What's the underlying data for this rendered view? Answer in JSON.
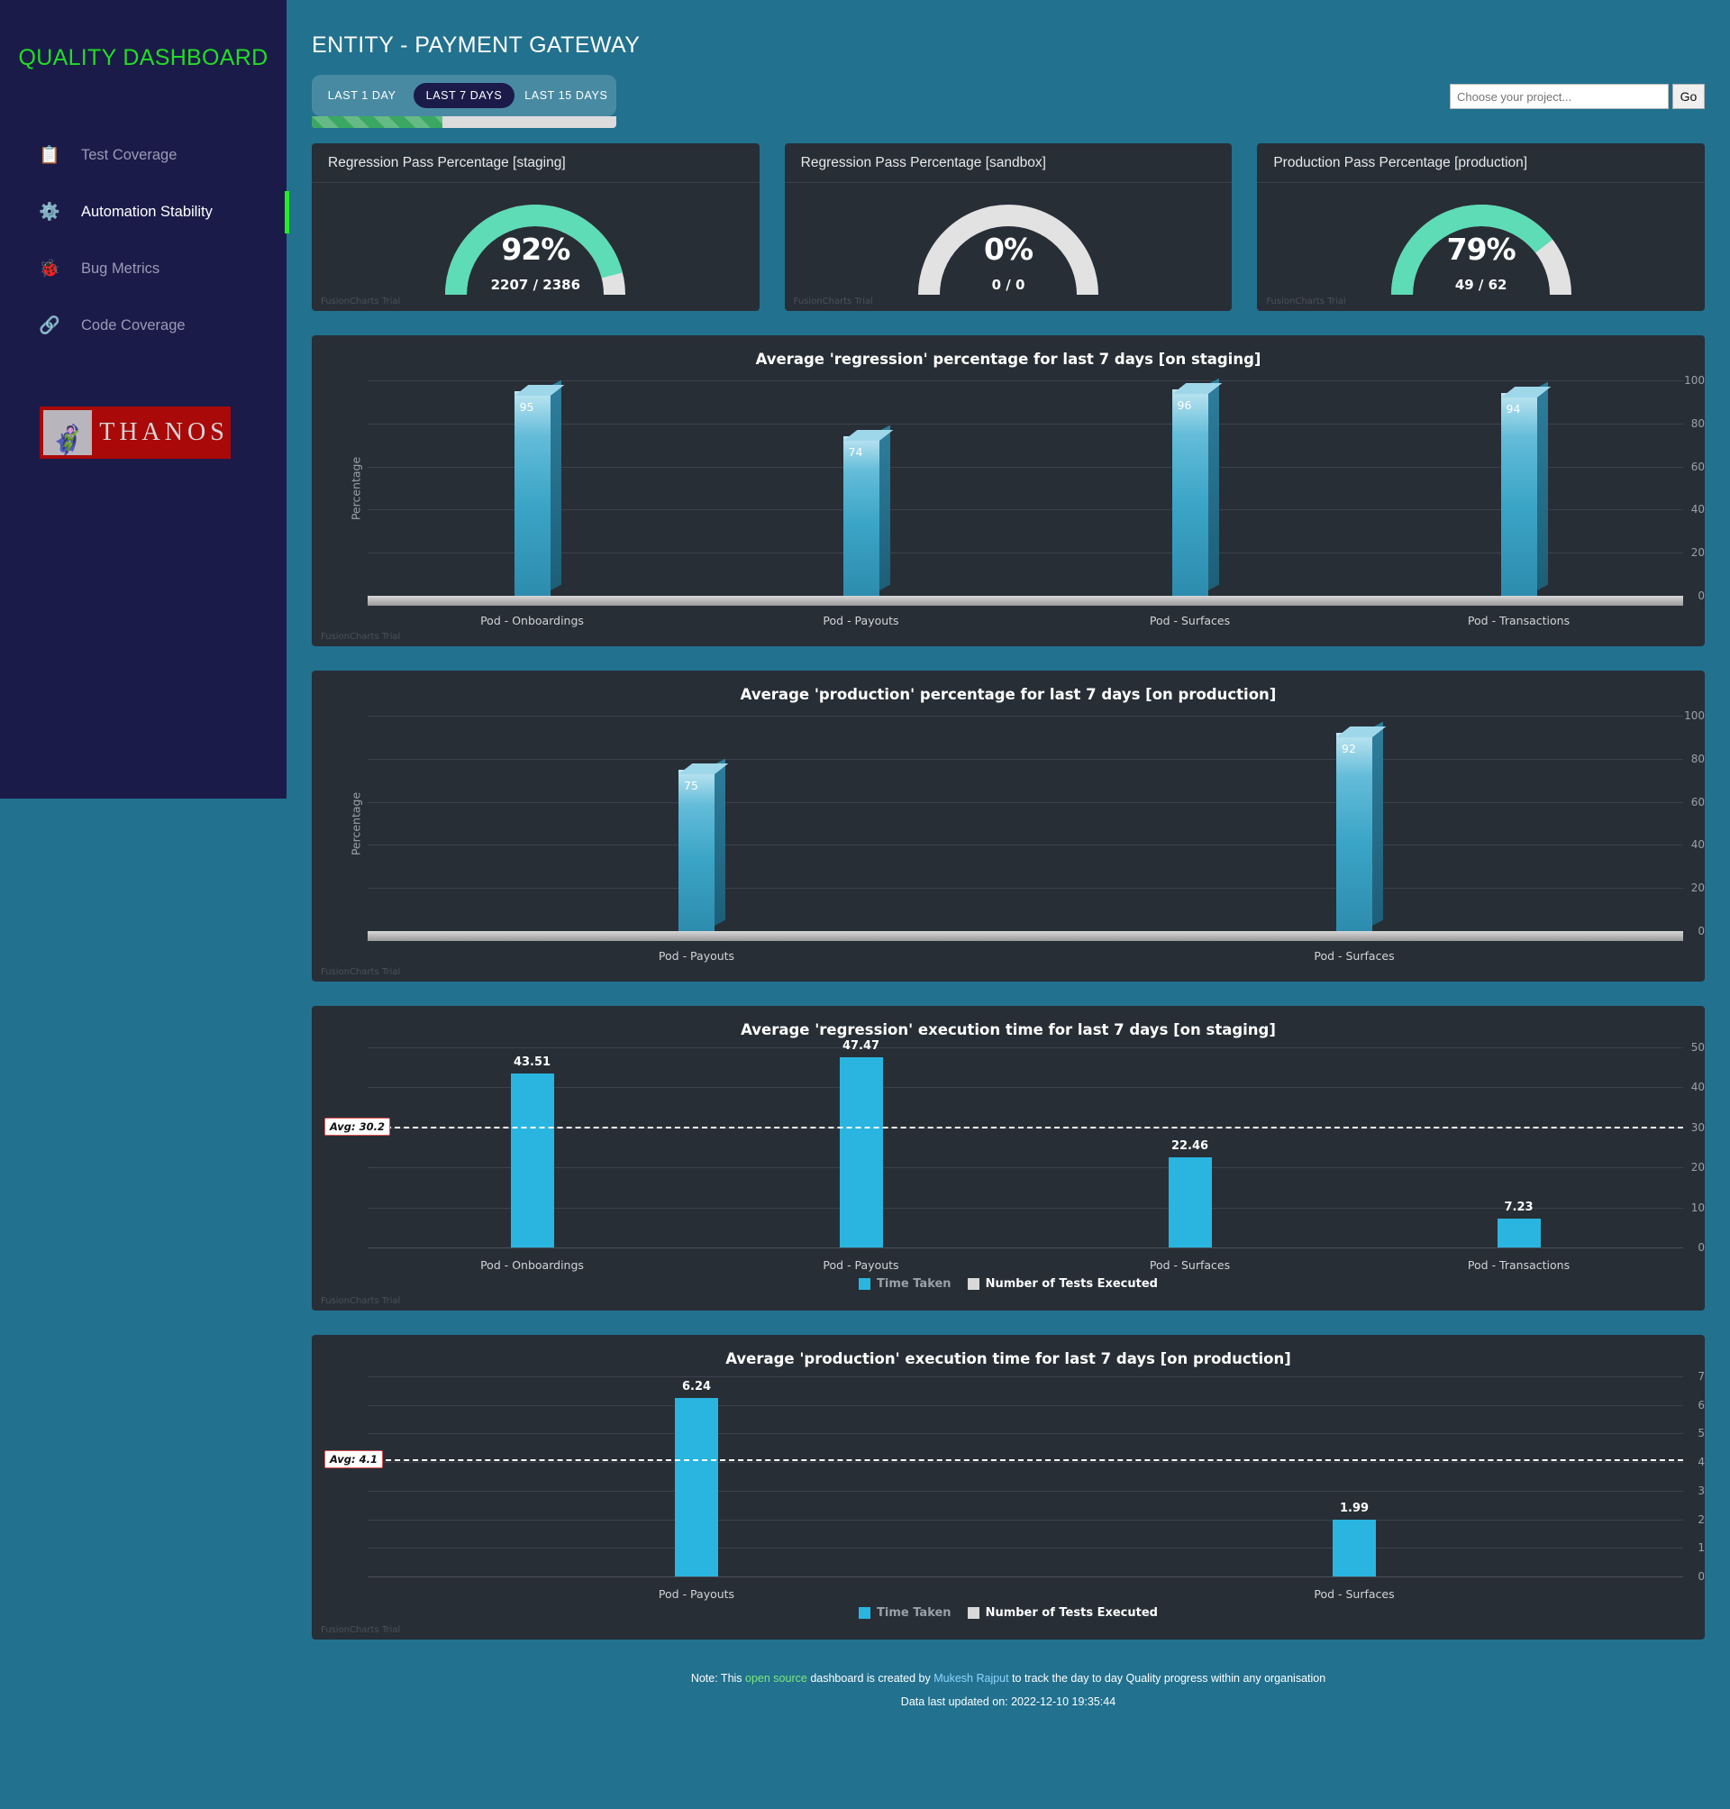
{
  "sidebar": {
    "brand": "QUALITY DASHBOARD",
    "items": [
      {
        "label": "Test Coverage",
        "icon": "clipboard-check-icon",
        "glyph": "📋",
        "active": false
      },
      {
        "label": "Automation Stability",
        "icon": "gears-icon",
        "glyph": "⚙",
        "active": true
      },
      {
        "label": "Bug Metrics",
        "icon": "bug-report-icon",
        "glyph": "🐞",
        "active": false
      },
      {
        "label": "Code Coverage",
        "icon": "code-graph-icon",
        "glyph": "🔗",
        "active": false
      }
    ],
    "logo": {
      "text": "THANOS",
      "figure": "🦸"
    }
  },
  "header": {
    "title": "ENTITY - PAYMENT GATEWAY",
    "tabs": [
      {
        "label": "LAST 1 DAY",
        "active": false
      },
      {
        "label": "LAST 7 DAYS",
        "active": true
      },
      {
        "label": "LAST 15 DAYS",
        "active": false
      }
    ],
    "progress_percent": 43,
    "search": {
      "placeholder": "Choose your project...",
      "value": "",
      "button_label": "Go"
    }
  },
  "gauges": [
    {
      "title": "Regression Pass Percentage [staging]",
      "value": "92%",
      "percent": 92,
      "sub": "2207 / 2386",
      "watermark": "FusionCharts Trial",
      "color": "#5ddcb6"
    },
    {
      "title": "Regression Pass Percentage [sandbox]",
      "value": "0%",
      "percent": 0,
      "sub": "0 / 0",
      "watermark": "FusionCharts Trial",
      "color": "#5ddcb6"
    },
    {
      "title": "Production Pass Percentage [production]",
      "value": "79%",
      "percent": 79,
      "sub": "49 / 62",
      "watermark": "FusionCharts Trial",
      "color": "#5ddcb6"
    }
  ],
  "chart_data": [
    {
      "id": "regression-percentage-staging",
      "type": "bar",
      "title": "Average 'regression' percentage for last 7 days [on staging]",
      "xlabel": "",
      "ylabel": "Percentage",
      "categories": [
        "Pod - Onboardings",
        "Pod - Payouts",
        "Pod - Surfaces",
        "Pod - Transactions"
      ],
      "values": [
        95,
        74,
        96,
        94
      ],
      "yticks": [
        0,
        20,
        40,
        60,
        80,
        100
      ],
      "ylim": [
        0,
        100
      ],
      "grid": true,
      "style": "3d-column",
      "watermark": "FusionCharts Trial"
    },
    {
      "id": "production-percentage-production",
      "type": "bar",
      "title": "Average 'production' percentage for last 7 days [on production]",
      "xlabel": "",
      "ylabel": "Percentage",
      "categories": [
        "Pod - Payouts",
        "Pod - Surfaces"
      ],
      "values": [
        75,
        92
      ],
      "yticks": [
        0,
        20,
        40,
        60,
        80,
        100
      ],
      "ylim": [
        0,
        100
      ],
      "grid": true,
      "style": "3d-column",
      "watermark": "FusionCharts Trial"
    },
    {
      "id": "regression-execution-time-staging",
      "type": "bar",
      "title": "Average 'regression' execution time for last 7 days [on staging]",
      "xlabel": "",
      "ylabel": "",
      "categories": [
        "Pod - Onboardings",
        "Pod - Payouts",
        "Pod - Surfaces",
        "Pod - Transactions"
      ],
      "values": [
        43.51,
        47.47,
        22.46,
        7.23
      ],
      "value_labels": [
        "43.51",
        "47.47",
        "22.46",
        "7.23"
      ],
      "yticks": [
        0,
        10,
        20,
        30,
        40,
        50
      ],
      "ylim": [
        0,
        50
      ],
      "grid": true,
      "style": "flat-column",
      "average": {
        "value": 30.2,
        "label": "Avg: 30.2"
      },
      "legend": [
        {
          "name": "Time Taken",
          "color": "#29b5e0"
        },
        {
          "name": "Number of Tests Executed",
          "color": "#d9d9d9"
        }
      ],
      "legend_position": "bottom",
      "watermark": "FusionCharts Trial"
    },
    {
      "id": "production-execution-time-production",
      "type": "bar",
      "title": "Average 'production' execution time for last 7 days [on production]",
      "xlabel": "",
      "ylabel": "",
      "categories": [
        "Pod - Payouts",
        "Pod - Surfaces"
      ],
      "values": [
        6.24,
        1.99
      ],
      "value_labels": [
        "6.24",
        "1.99"
      ],
      "yticks": [
        0,
        1,
        2,
        3,
        4,
        5,
        6,
        7
      ],
      "ylim": [
        0,
        7
      ],
      "grid": true,
      "style": "flat-column",
      "average": {
        "value": 4.1,
        "label": "Avg: 4.1"
      },
      "legend": [
        {
          "name": "Time Taken",
          "color": "#29b5e0"
        },
        {
          "name": "Number of Tests Executed",
          "color": "#d9d9d9"
        }
      ],
      "legend_position": "bottom",
      "watermark": "FusionCharts Trial"
    }
  ],
  "footer": {
    "note_prefix": "Note: This ",
    "link_open_source": "open source",
    "note_mid": " dashboard is created by ",
    "link_author": "Mukesh Rajput",
    "note_suffix": " to track the day to day Quality progress within any organisation",
    "updated": "Data last updated on: 2022-12-10 19:35:44"
  },
  "colors": {
    "accent_green": "#22ee22",
    "page_bg": "#21718f",
    "sidebar_bg": "#1b1b4a",
    "card_bg": "#282e36",
    "gauge_teal": "#5ddcb6",
    "bar_blue": "#29b5e0"
  }
}
